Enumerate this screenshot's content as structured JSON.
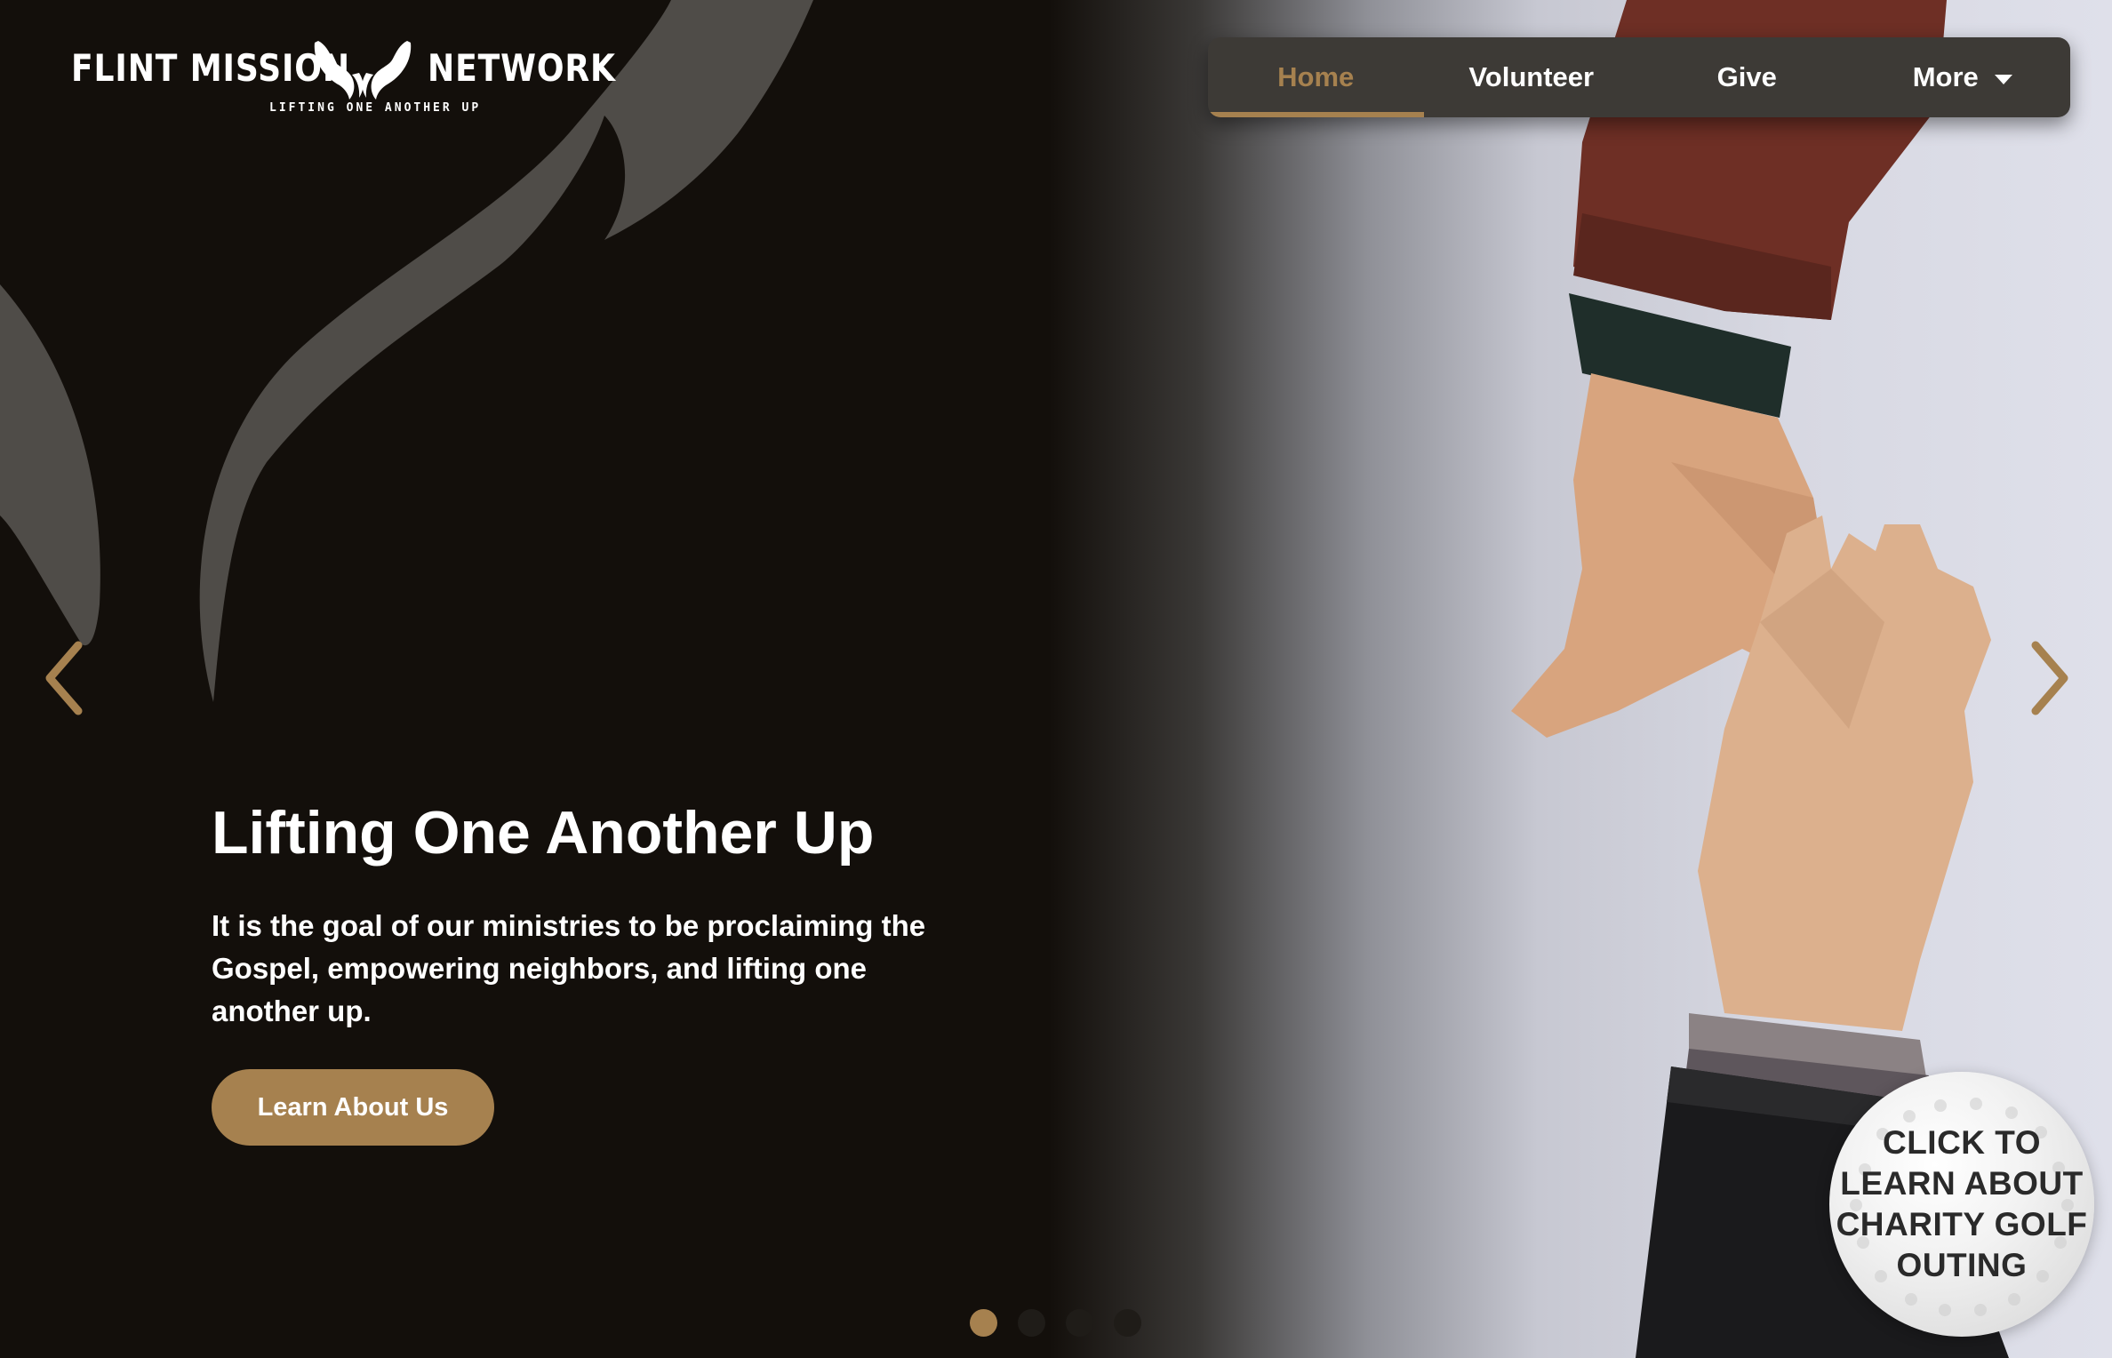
{
  "logo": {
    "left_word": "FLINT MISSION",
    "right_word": "NETWORK",
    "tagline": "LIFTING ONE ANOTHER UP",
    "mark_icon": "hands-lifting-icon"
  },
  "nav": {
    "items": [
      {
        "label": "Home",
        "active": true
      },
      {
        "label": "Volunteer",
        "active": false
      },
      {
        "label": "Give",
        "active": false
      },
      {
        "label": "More",
        "active": false,
        "icon": "caret-down-icon"
      }
    ]
  },
  "hero": {
    "headline": "Lifting One Another Up",
    "subtext": "It is the goal of our ministries to be proclaiming the Gospel, empowering neighbors, and lifting one another up.",
    "cta_label": "Learn About Us",
    "prev_icon": "chevron-left-icon",
    "next_icon": "chevron-right-icon",
    "slides": {
      "count": 4,
      "active_index": 0
    }
  },
  "badge": {
    "lines": [
      "CLICK TO",
      "LEARN ABOUT",
      "CHARITY GOLF",
      "OUTING"
    ]
  },
  "colors": {
    "background": "#130f0b",
    "accent": "#a6814f",
    "nav_background": "#3d3a36",
    "text": "#ffffff"
  }
}
